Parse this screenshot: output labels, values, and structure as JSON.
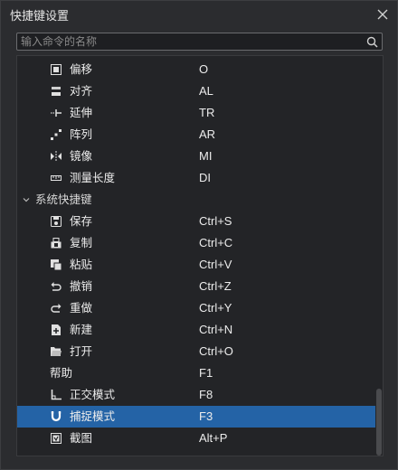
{
  "window": {
    "title": "快捷键设置"
  },
  "search": {
    "placeholder": "输入命令的名称",
    "value": ""
  },
  "rows": [
    {
      "type": "item",
      "icon": "offset-icon",
      "name": "偏移",
      "key": "O"
    },
    {
      "type": "item",
      "icon": "align-icon",
      "name": "对齐",
      "key": "AL"
    },
    {
      "type": "item",
      "icon": "extend-icon",
      "name": "延伸",
      "key": "TR"
    },
    {
      "type": "item",
      "icon": "array-icon",
      "name": "阵列",
      "key": "AR"
    },
    {
      "type": "item",
      "icon": "mirror-icon",
      "name": "镜像",
      "key": "MI"
    },
    {
      "type": "item",
      "icon": "measure-icon",
      "name": "测量长度",
      "key": "DI"
    },
    {
      "type": "group",
      "name": "系统快捷键"
    },
    {
      "type": "item",
      "icon": "save-icon",
      "name": "保存",
      "key": "Ctrl+S"
    },
    {
      "type": "item",
      "icon": "copy-icon",
      "name": "复制",
      "key": "Ctrl+C"
    },
    {
      "type": "item",
      "icon": "paste-icon",
      "name": "粘贴",
      "key": "Ctrl+V"
    },
    {
      "type": "item",
      "icon": "undo-icon",
      "name": "撤销",
      "key": "Ctrl+Z"
    },
    {
      "type": "item",
      "icon": "redo-icon",
      "name": "重做",
      "key": "Ctrl+Y"
    },
    {
      "type": "item",
      "icon": "new-file-icon",
      "name": "新建",
      "key": "Ctrl+N"
    },
    {
      "type": "item",
      "icon": "open-folder-icon",
      "name": "打开",
      "key": "Ctrl+O"
    },
    {
      "type": "item",
      "icon": "",
      "name": "帮助",
      "key": "F1"
    },
    {
      "type": "item",
      "icon": "ortho-icon",
      "name": "正交模式",
      "key": "F8"
    },
    {
      "type": "item",
      "icon": "magnet-icon",
      "name": "捕捉模式",
      "key": "F3",
      "selected": true
    },
    {
      "type": "item",
      "icon": "screenshot-icon",
      "name": "截图",
      "key": "Alt+P"
    }
  ],
  "colors": {
    "selection": "#2463a6",
    "background": "#2b2c2f",
    "panel": "#232427"
  }
}
